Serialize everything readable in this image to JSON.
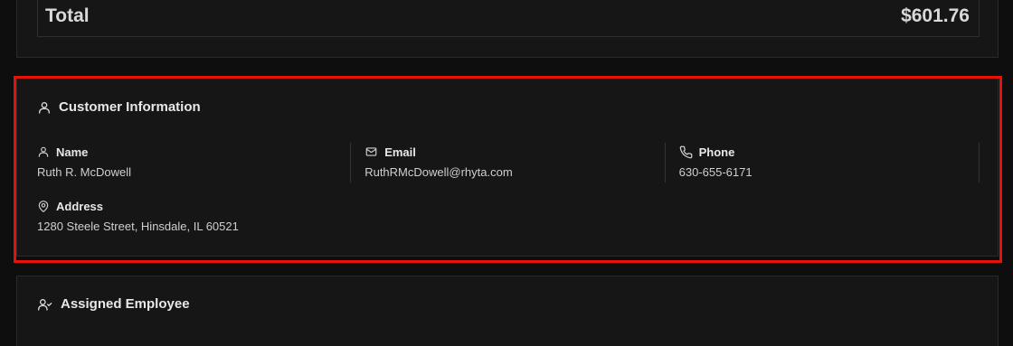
{
  "summary": {
    "total_label": "Total",
    "total_value": "$601.76"
  },
  "customer": {
    "title": "Customer Information",
    "title_icon": "user-icon",
    "name": {
      "label": "Name",
      "value": "Ruth R. McDowell",
      "icon": "user-icon"
    },
    "email": {
      "label": "Email",
      "value": "RuthRMcDowell@rhyta.com",
      "icon": "mail-icon"
    },
    "phone": {
      "label": "Phone",
      "value": "630-655-6171",
      "icon": "phone-icon"
    },
    "address": {
      "label": "Address",
      "value": "1280 Steele Street, Hinsdale, IL 60521",
      "icon": "map-pin-icon"
    }
  },
  "employee": {
    "title": "Assigned Employee",
    "title_icon": "user-check-icon"
  },
  "colors": {
    "background": "#0e0e0e",
    "card": "#161616",
    "highlight": "#e3120b"
  }
}
